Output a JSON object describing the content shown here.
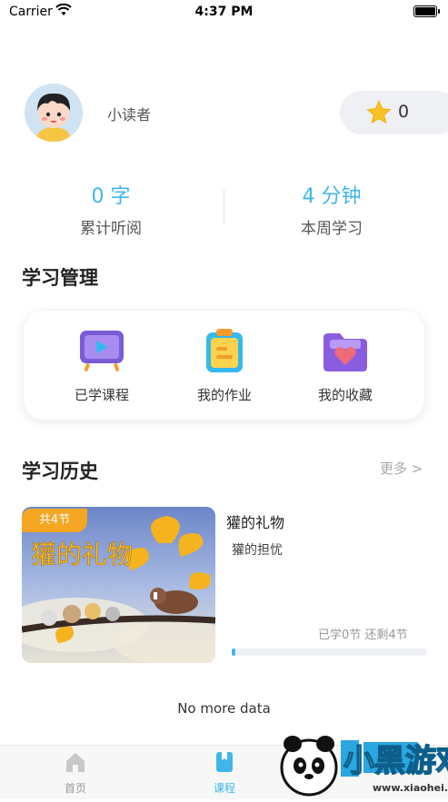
{
  "status_bar": {
    "carrier": "Carrier",
    "time": "4:37 PM"
  },
  "profile": {
    "username": "小读者",
    "stars": "0"
  },
  "stats": [
    {
      "value": "0 字",
      "label": "累计听阅"
    },
    {
      "value": "4 分钟",
      "label": "本周学习"
    }
  ],
  "management": {
    "title": "学习管理",
    "items": [
      {
        "label": "已学课程",
        "icon": "tv-icon"
      },
      {
        "label": "我的作业",
        "icon": "homework-icon"
      },
      {
        "label": "我的收藏",
        "icon": "favorites-folder-icon"
      }
    ]
  },
  "history": {
    "title": "学习历史",
    "more_label": "更多 >",
    "course": {
      "badge": "共4节",
      "cover_text": "獾的礼物",
      "title": "獾的礼物",
      "subtitle": "獾的担忧",
      "progress_text": "已学0节  还剩4节",
      "progress": 0.0
    }
  },
  "footer_text": "No more data",
  "tabs": [
    {
      "label": "首页",
      "active": false
    },
    {
      "label": "课程",
      "active": true
    }
  ],
  "watermark": {
    "text": "小黑游戏",
    "url_text": "www.xiaohei.com"
  },
  "colors": {
    "accent": "#3fb6ea",
    "badge": "#f5a623",
    "tab_inactive": "#999999"
  }
}
